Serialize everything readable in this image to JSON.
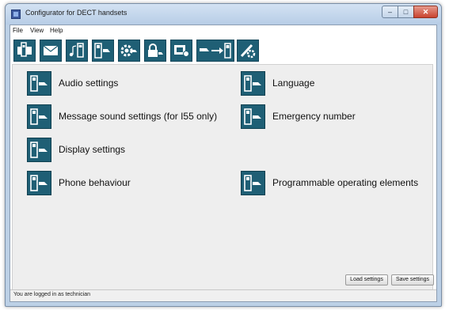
{
  "window": {
    "title": "Configurator for DECT handsets",
    "min_glyph": "–",
    "max_glyph": "□",
    "close_glyph": "✕"
  },
  "menu": {
    "items": [
      "File",
      "View",
      "Help"
    ]
  },
  "toolbar": {
    "icons": [
      "handset-in-cradle-icon",
      "envelope-icon",
      "music-notes-icon",
      "handset-settings-icon",
      "gear-settings-icon",
      "lock-icon",
      "display-settings-icon",
      "transfer-to-handset-icon",
      "wrench-gear-icon"
    ]
  },
  "settings": {
    "left": [
      {
        "label": "Audio settings"
      },
      {
        "label": "Message sound settings (for I55 only)"
      },
      {
        "label": "Display settings"
      },
      {
        "label": "Phone behaviour"
      }
    ],
    "right": [
      {
        "label": "Language"
      },
      {
        "label": "Emergency number"
      },
      {
        "label": "Programmable operating elements"
      }
    ]
  },
  "buttons": {
    "load": "Load settings",
    "save": "Save settings"
  },
  "status": {
    "text": "You are logged in as technician"
  }
}
